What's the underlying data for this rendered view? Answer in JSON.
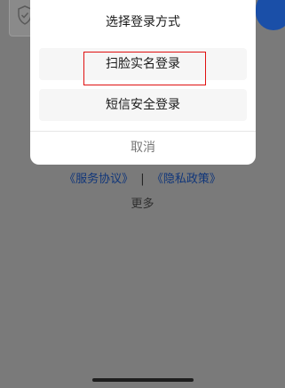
{
  "background": {
    "links": {
      "service_agreement": "《服务协议》",
      "separator": "|",
      "privacy_policy": "《隐私政策》"
    },
    "more_label": "更多",
    "overlay_color": "#7a7a7a",
    "accent_color": "#1a4fa8"
  },
  "sheet": {
    "title": "选择登录方式",
    "options": [
      {
        "label": "扫脸实名登录",
        "highlighted": true
      },
      {
        "label": "短信安全登录",
        "highlighted": false
      }
    ],
    "cancel_label": "取消",
    "highlight_color": "#e01010"
  },
  "icons": {
    "shield": "shield-check-icon"
  }
}
